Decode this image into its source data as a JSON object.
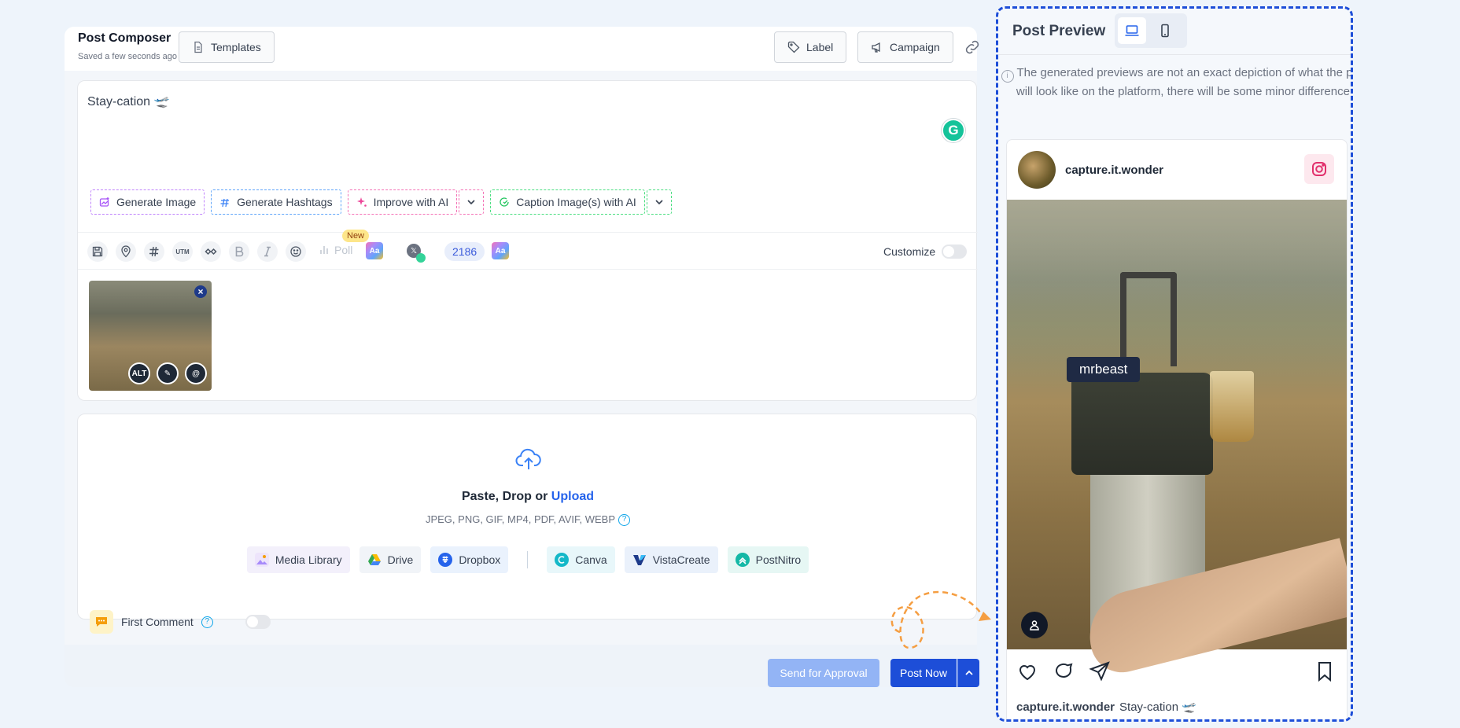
{
  "composer": {
    "title": "Post Composer",
    "subtitle": "Saved a few seconds ago",
    "templates_label": "Templates",
    "label_label": "Label",
    "campaign_label": "Campaign",
    "post_text": "Stay-cation 🛫",
    "ai": {
      "generate_image": "Generate Image",
      "generate_hashtags": "Generate Hashtags",
      "improve": "Improve with AI",
      "caption": "Caption Image(s) with AI"
    },
    "toolbar": {
      "utm": "UTM",
      "poll": "Poll",
      "new_badge": "New",
      "aa": "Aa",
      "counter": "2186",
      "customize": "Customize"
    },
    "thumb_tools": {
      "alt": "ALT",
      "edit": "✎",
      "mention": "@"
    },
    "upload": {
      "title_prefix": "Paste, Drop or ",
      "title_link": "Upload",
      "formats": "JPEG, PNG, GIF, MP4, PDF, AVIF, WEBP",
      "sources": [
        "Media Library",
        "Drive",
        "Dropbox",
        "Canva",
        "VistaCreate",
        "PostNitro"
      ]
    },
    "first_comment": "First Comment",
    "send_approval": "Send for Approval",
    "post_now": "Post Now"
  },
  "preview": {
    "title": "Post Preview",
    "note": "The generated previews are not an exact depiction of what the post will look like on the platform, there will be some minor difference.",
    "username": "capture.it.wonder",
    "tag_label": "mrbeast",
    "caption_user": "capture.it.wonder",
    "caption_text": "Stay-cation 🛫"
  },
  "colors": {
    "primary": "#1d4ed8",
    "primary_disabled": "#93b4f5",
    "instagram": "#e1306c",
    "pointer": "#f59e42"
  }
}
